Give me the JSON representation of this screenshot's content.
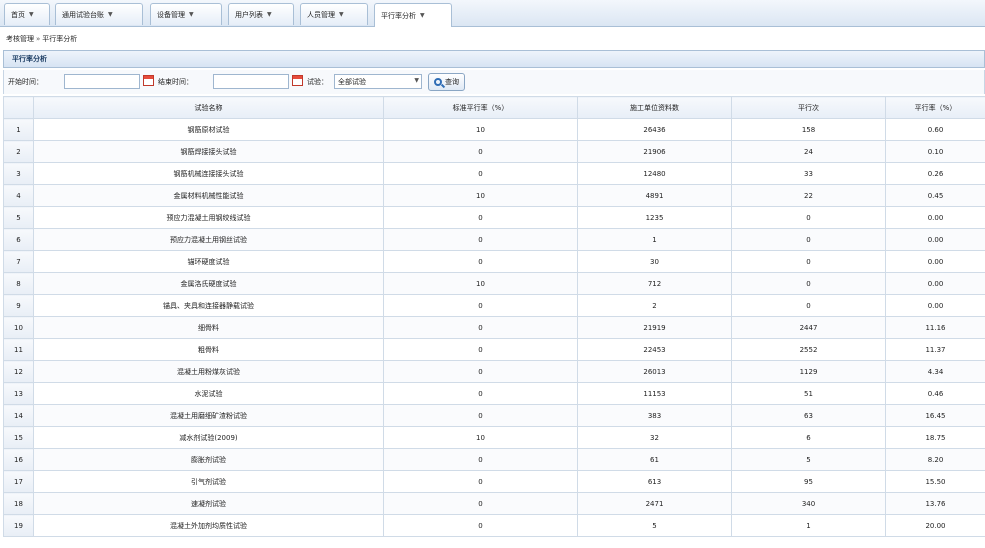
{
  "tabs": [
    {
      "label": "首页",
      "active": false
    },
    {
      "label": "通用试验台账",
      "active": false
    },
    {
      "label": "设备管理",
      "active": false
    },
    {
      "label": "用户列表",
      "active": false
    },
    {
      "label": "人员管理",
      "active": false
    },
    {
      "label": "平行率分析",
      "active": true
    }
  ],
  "breadcrumb": {
    "part1": "考核管理",
    "separator": "»",
    "part2": "平行率分析"
  },
  "panel": {
    "title": "平行率分析"
  },
  "filter": {
    "start_label": "开始时间：",
    "start_value": "",
    "end_label": "结束时间：",
    "end_value": "",
    "type_label": "试验：",
    "type_value": "全部试验",
    "query_label": "查询"
  },
  "table": {
    "headers": [
      "",
      "试验名称",
      "标准平行率（%）",
      "施工单位资料数",
      "平行次",
      "平行率（%）"
    ],
    "rows": [
      [
        "1",
        "钢筋原材试验",
        "10",
        "26436",
        "158",
        "0.60"
      ],
      [
        "2",
        "钢筋焊接接头试验",
        "0",
        "21906",
        "24",
        "0.10"
      ],
      [
        "3",
        "钢筋机械连接接头试验",
        "0",
        "12480",
        "33",
        "0.26"
      ],
      [
        "4",
        "金属材料机械性能试验",
        "10",
        "4891",
        "22",
        "0.45"
      ],
      [
        "5",
        "预应力混凝土用钢绞线试验",
        "0",
        "1235",
        "0",
        "0.00"
      ],
      [
        "6",
        "预应力混凝土用钢丝试验",
        "0",
        "1",
        "0",
        "0.00"
      ],
      [
        "7",
        "锚环硬度试验",
        "0",
        "30",
        "0",
        "0.00"
      ],
      [
        "8",
        "金属洛氏硬度试验",
        "10",
        "712",
        "0",
        "0.00"
      ],
      [
        "9",
        "锚具、夹具和连接器静载试验",
        "0",
        "2",
        "0",
        "0.00"
      ],
      [
        "10",
        "细骨料",
        "0",
        "21919",
        "2447",
        "11.16"
      ],
      [
        "11",
        "粗骨料",
        "0",
        "22453",
        "2552",
        "11.37"
      ],
      [
        "12",
        "混凝土用粉煤灰试验",
        "0",
        "26013",
        "1129",
        "4.34"
      ],
      [
        "13",
        "水泥试验",
        "0",
        "11153",
        "51",
        "0.46"
      ],
      [
        "14",
        "混凝土用磨细矿渣粉试验",
        "0",
        "383",
        "63",
        "16.45"
      ],
      [
        "15",
        "减水剂试验(2009)",
        "10",
        "32",
        "6",
        "18.75"
      ],
      [
        "16",
        "膨胀剂试验",
        "0",
        "61",
        "5",
        "8.20"
      ],
      [
        "17",
        "引气剂试验",
        "0",
        "613",
        "95",
        "15.50"
      ],
      [
        "18",
        "速凝剂试验",
        "0",
        "2471",
        "340",
        "13.76"
      ],
      [
        "19",
        "混凝土外加剂均质性试验",
        "0",
        "5",
        "1",
        "20.00"
      ]
    ]
  },
  "colors": {
    "accent": "#2f6db5",
    "border": "#a9bfd6"
  },
  "icons": {
    "tab_dropdown": "chevron-down-icon",
    "calendar": "calendar-icon",
    "query": "search-icon",
    "select": "chevron-down-icon"
  }
}
